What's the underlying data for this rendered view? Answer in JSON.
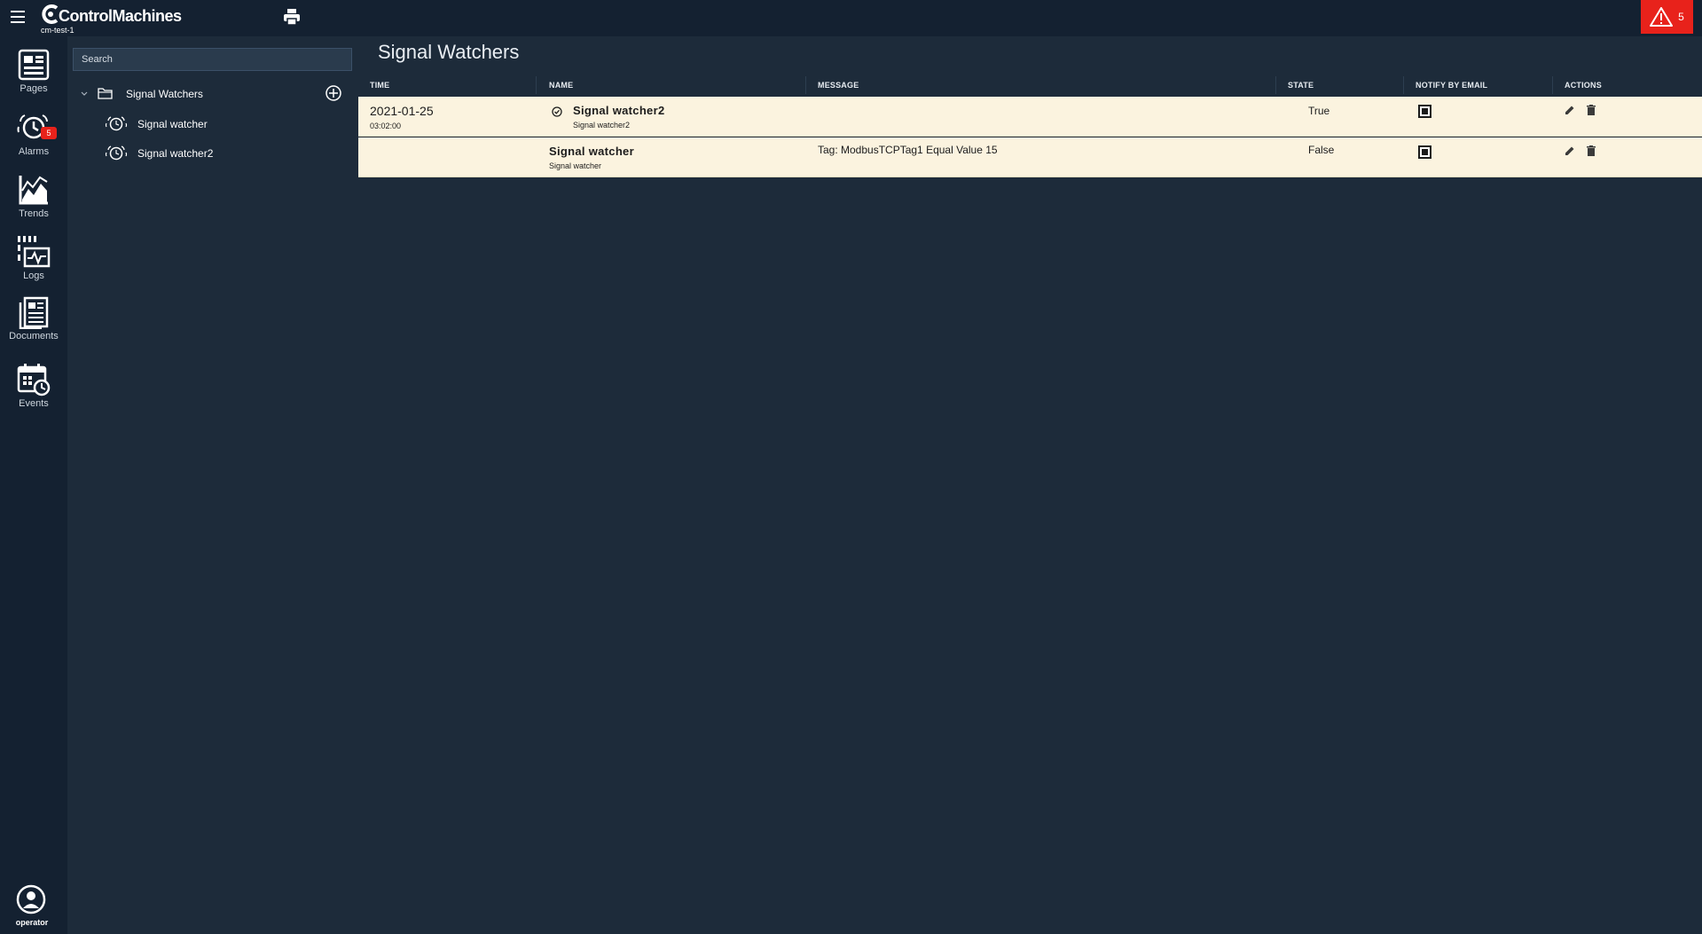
{
  "app": {
    "brand": "ControlMachines",
    "device": "cm-test-1",
    "alarm_count": "5",
    "colors": {
      "accent_red": "#e8221b",
      "bg": "#1d2b3a",
      "row_bg": "#fbf3df"
    }
  },
  "rail": {
    "items": [
      {
        "label": "Pages",
        "icon": "pages-icon"
      },
      {
        "label": "Alarms",
        "icon": "alarm-clock-icon",
        "badge": "5"
      },
      {
        "label": "Trends",
        "icon": "trends-chart-icon"
      },
      {
        "label": "Logs",
        "icon": "logs-icon"
      },
      {
        "label": "Documents",
        "icon": "documents-icon"
      },
      {
        "label": "Events",
        "icon": "events-calendar-icon"
      }
    ],
    "user": "operator"
  },
  "tree": {
    "search_placeholder": "Search",
    "folder": "Signal Watchers",
    "items": [
      {
        "label": "Signal watcher"
      },
      {
        "label": "Signal watcher2"
      }
    ]
  },
  "main": {
    "title": "Signal Watchers",
    "columns": {
      "time": "TIME",
      "name": "NAME",
      "message": "MESSAGE",
      "state": "STATE",
      "notify": "NOTIFY BY EMAIL",
      "actions": "ACTIONS"
    },
    "rows": [
      {
        "date": "2021-01-25",
        "time": "03:02:00",
        "name": "Signal watcher2",
        "subname": "Signal watcher2",
        "message": "",
        "state": "True",
        "notify": true
      },
      {
        "date": "",
        "time": "",
        "name": "Signal watcher",
        "subname": "Signal watcher",
        "message": "Tag: ModbusTCPTag1 Equal Value 15",
        "state": "False",
        "notify": true
      }
    ]
  }
}
